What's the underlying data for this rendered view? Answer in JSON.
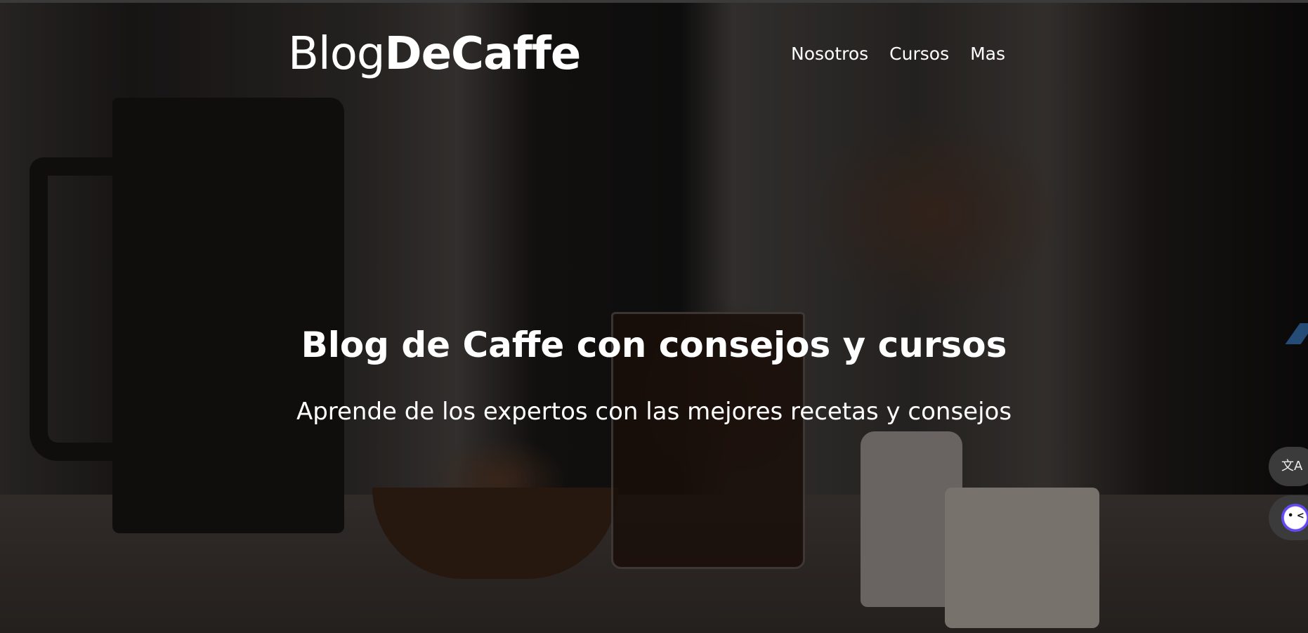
{
  "header": {
    "logo_light": "Blog",
    "logo_bold": "DeCaffe",
    "nav": [
      {
        "label": "Nosotros"
      },
      {
        "label": "Cursos"
      },
      {
        "label": "Mas"
      }
    ]
  },
  "hero": {
    "title": "Blog de Caffe con consejos y cursos",
    "subtitle": "Aprende de los expertos con las mejores recetas y consejos"
  },
  "widgets": {
    "translate_icon": "文A",
    "assistant_icon": "assistant-face-icon"
  }
}
